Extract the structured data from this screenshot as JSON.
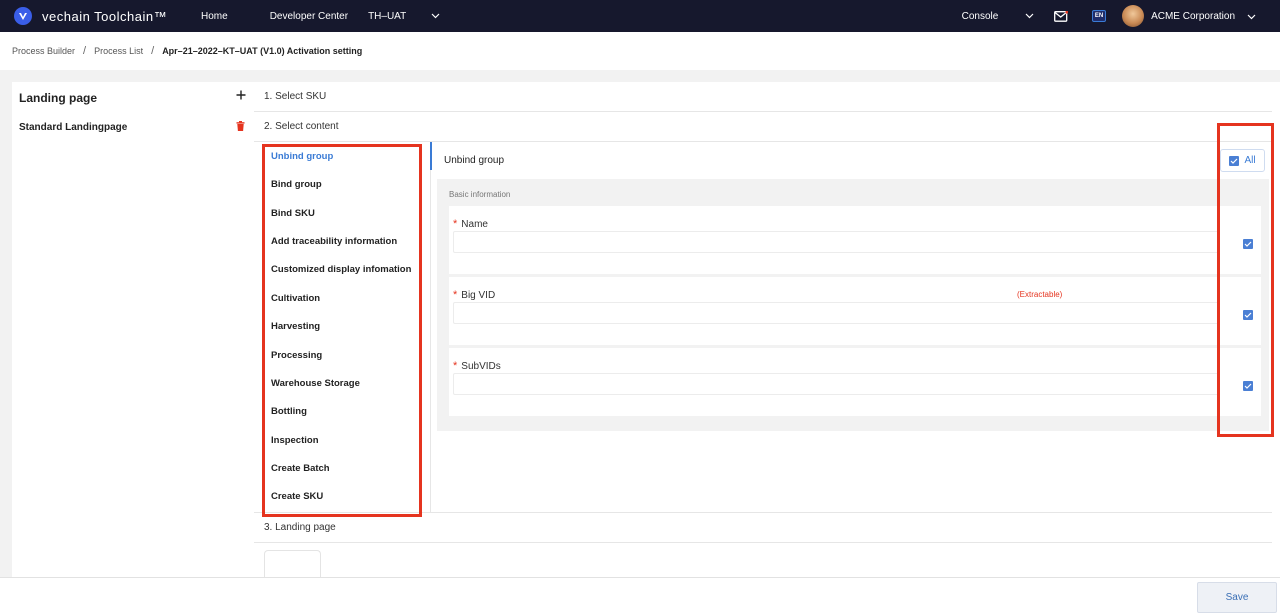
{
  "header": {
    "logo_text": "vechain Toolchain™",
    "nav": [
      "Home",
      "Developer Center",
      "TH–UAT"
    ],
    "console_label": "Console",
    "lang_badge": "EN",
    "org_name": "ACME Corporation"
  },
  "breadcrumb": {
    "items": [
      "Process Builder",
      "Process List"
    ],
    "current": "Apr–21–2022–KT–UAT (V1.0) Activation setting"
  },
  "sidebar": {
    "title": "Landing page",
    "add_icon": "plus-icon",
    "items": [
      {
        "label": "Standard Landingpage",
        "icon": "trash-icon"
      }
    ]
  },
  "steps": {
    "step1": "1. Select SKU",
    "step2": "2. Select content",
    "step3": "3. Landing page"
  },
  "content_list": [
    "Unbind group",
    "Bind group",
    "Bind SKU",
    "Add traceability information",
    "Customized display infomation",
    "Cultivation",
    "Harvesting",
    "Processing",
    "Warehouse Storage",
    "Bottling",
    "Inspection",
    "Create Batch",
    "Create SKU"
  ],
  "active_item": "Unbind group",
  "detail": {
    "title": "Unbind group",
    "all_label": "All",
    "all_checked": true,
    "section_label": "Basic information",
    "fields": [
      {
        "label": "Name",
        "required": true,
        "note": "",
        "value": "",
        "checked": true
      },
      {
        "label": "Big VID",
        "required": true,
        "note": "(Extractable)",
        "value": "",
        "checked": true
      },
      {
        "label": "SubVIDs",
        "required": true,
        "note": "",
        "value": "",
        "checked": true
      }
    ]
  },
  "footer": {
    "save_label": "Save"
  },
  "colors": {
    "accent": "#3a7bd5",
    "nav_bg": "#16182d",
    "highlight": "#e5341f",
    "required": "#e5341f"
  }
}
